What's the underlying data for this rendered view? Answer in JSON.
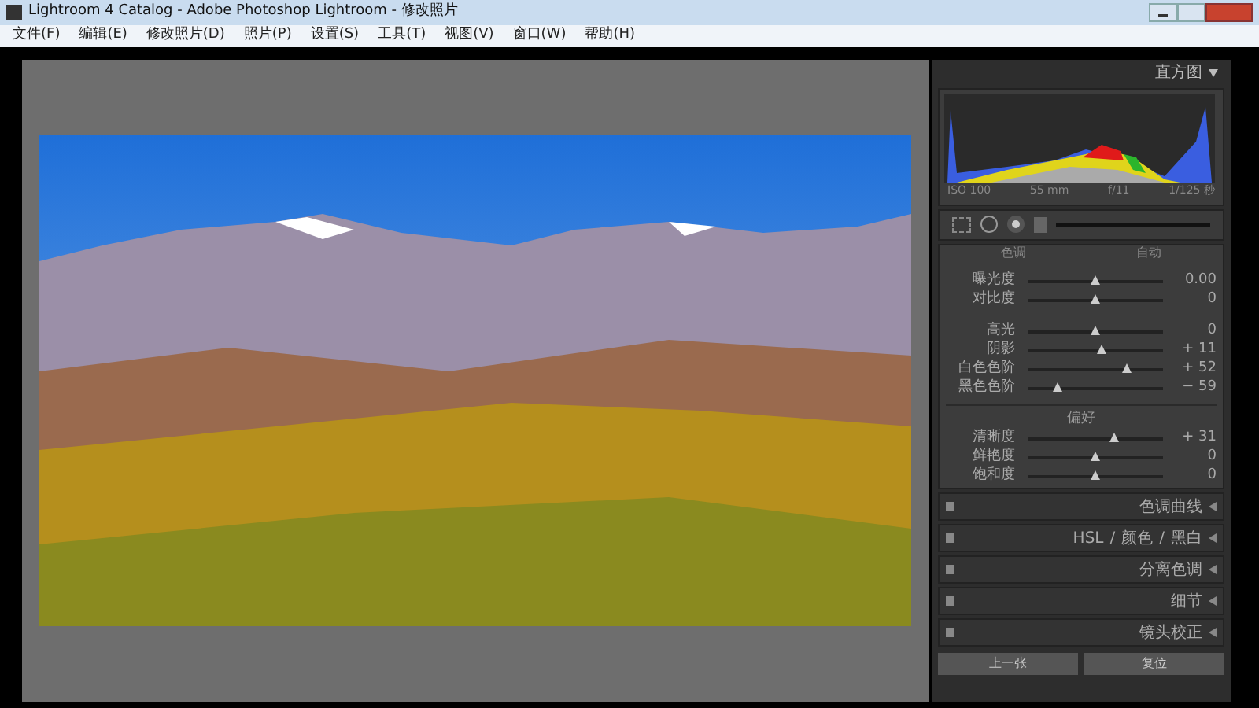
{
  "window": {
    "title": "Lightroom 4 Catalog - Adobe Photoshop Lightroom - 修改照片"
  },
  "menu": [
    "文件(F)",
    "编辑(E)",
    "修改照片(D)",
    "照片(P)",
    "设置(S)",
    "工具(T)",
    "视图(V)",
    "窗口(W)",
    "帮助(H)"
  ],
  "histogram": {
    "title": "直方图",
    "info": [
      "ISO 100",
      "55 mm",
      "f/11",
      "1/125 秒"
    ]
  },
  "basic": {
    "header": [
      "色调",
      "自动"
    ],
    "groups": [
      [
        {
          "label": "曝光度",
          "level": 0.5,
          "reading": "0.00"
        },
        {
          "label": "对比度",
          "level": 0.5,
          "reading": "0"
        }
      ],
      [
        {
          "label": "高光",
          "level": 0.5,
          "reading": "0"
        },
        {
          "label": "阴影",
          "level": 0.55,
          "reading": "+ 11"
        },
        {
          "label": "白色色阶",
          "level": 0.74,
          "reading": "+ 52"
        },
        {
          "label": "黑色色阶",
          "level": 0.22,
          "reading": "− 59"
        }
      ]
    ],
    "presence_title": "偏好",
    "presence": [
      {
        "label": "清晰度",
        "level": 0.64,
        "reading": "+ 31"
      },
      {
        "label": "鲜艳度",
        "level": 0.5,
        "reading": "0"
      },
      {
        "label": "饱和度",
        "level": 0.5,
        "reading": "0"
      }
    ]
  },
  "panels": [
    {
      "parts": [
        "色调曲线"
      ]
    },
    {
      "parts": [
        "HSL",
        "/",
        "颜色",
        "/",
        "黑白"
      ]
    },
    {
      "parts": [
        "分离色调"
      ]
    },
    {
      "parts": [
        "细节"
      ]
    },
    {
      "parts": [
        "镜头校正"
      ]
    }
  ],
  "buttons": [
    "上一张",
    "复位"
  ]
}
